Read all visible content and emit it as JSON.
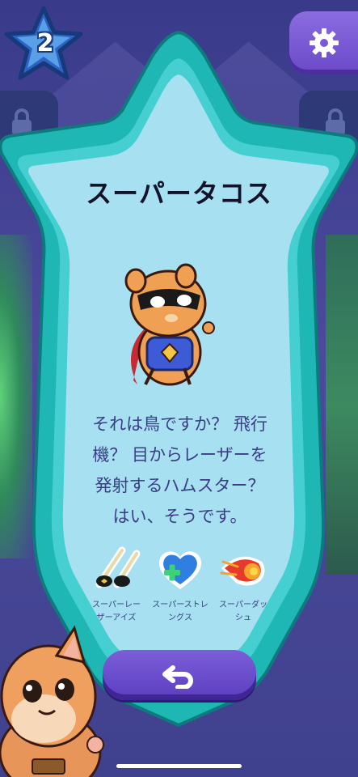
{
  "level": {
    "number": "2"
  },
  "card": {
    "title": "スーパータコス",
    "description_lines": [
      "それは鳥ですか？ 飛行",
      "機？ 目からレーザーを",
      "発射するハムスター？",
      "はい、そうです。"
    ]
  },
  "abilities": [
    {
      "label_lines": [
        "スーパーレー",
        "ザーアイズ"
      ],
      "icon": "laser-eyes-icon"
    },
    {
      "label_lines": [
        "スーパーストレ",
        "ングス"
      ],
      "icon": "heart-plus-icon"
    },
    {
      "label_lines": [
        "スーパーダッ",
        "シュ"
      ],
      "icon": "fireball-icon"
    }
  ],
  "icons": {
    "settings": "gear-icon",
    "back": "back-arrow-icon",
    "locks": "padlock-icon"
  },
  "colors": {
    "star_outer": "#1fb7b3",
    "star_inner": "#a5dff0",
    "button_purple": "#6a49c8",
    "text_dark": "#12122a",
    "text_body": "#3a3d84"
  }
}
